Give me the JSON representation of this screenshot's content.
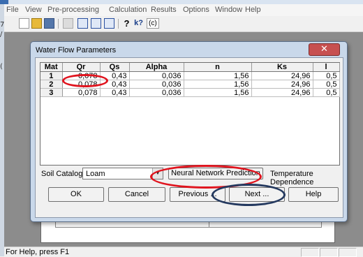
{
  "menu": [
    "File",
    "View",
    "Pre-processing",
    "Calculation",
    "Results",
    "Options",
    "Window",
    "Help"
  ],
  "toolbar": {
    "help1": "?",
    "help2": "k?",
    "copyright": "(c)"
  },
  "left_marks": [
    "7",
    "/",
    "("
  ],
  "dialog": {
    "title": "Water Flow Parameters",
    "close_glyph": "✕",
    "table": {
      "headers": [
        "Mat",
        "Qr",
        "Qs",
        "Alpha",
        "n",
        "Ks",
        "l"
      ],
      "rows": [
        [
          "1",
          "0,078",
          "0,43",
          "0,036",
          "1,56",
          "24,96",
          "0,5"
        ],
        [
          "2",
          "0,078",
          "0,43",
          "0,036",
          "1,56",
          "24,96",
          "0,5"
        ],
        [
          "3",
          "0,078",
          "0,43",
          "0,036",
          "1,56",
          "24,96",
          "0,5"
        ]
      ]
    },
    "soil_catalog_label": "Soil Catalog",
    "soil_catalog_value": "Loam",
    "neural_button": "Neural Network Prediction",
    "temperature_label": "Temperature Dependence",
    "buttons": {
      "ok": "OK",
      "cancel": "Cancel",
      "previous": "Previous ...",
      "next": "Next ...",
      "help": "Help"
    }
  },
  "status": {
    "text": "For Help, press F1"
  },
  "colors": {
    "highlight_red": "#e0141e",
    "highlight_navy": "#24395f",
    "dialog_frame": "#c9d8ea"
  }
}
